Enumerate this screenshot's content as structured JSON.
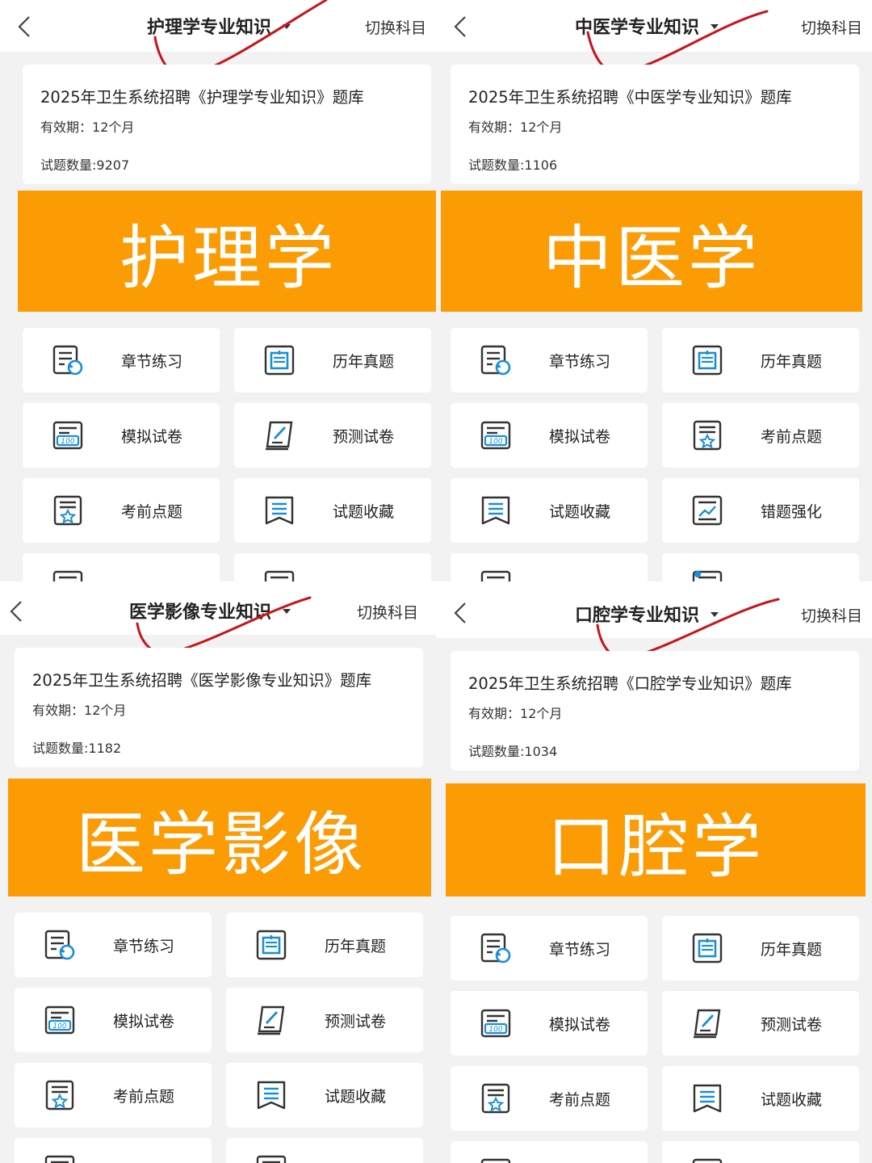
{
  "switch_label": "切换科目",
  "validity_label": "有效期：",
  "count_label": "试题数量:",
  "panels": [
    {
      "subject": "护理学专业知识",
      "bank_title": "2025年卫生系统招聘《护理学专业知识》题库",
      "validity": "12个月",
      "count": "9207",
      "banner": "护理学",
      "tiles": [
        {
          "label": "章节练习",
          "icon": "chapter-practice-icon"
        },
        {
          "label": "历年真题",
          "icon": "past-papers-icon"
        },
        {
          "label": "模拟试卷",
          "icon": "mock-exam-icon"
        },
        {
          "label": "预测试卷",
          "icon": "predicted-exam-icon"
        },
        {
          "label": "考前点题",
          "icon": "pre-exam-tips-icon"
        },
        {
          "label": "试题收藏",
          "icon": "favorites-icon"
        },
        {
          "label": "",
          "icon": "wrong-questions-icon"
        },
        {
          "label": "",
          "icon": "history-icon"
        }
      ]
    },
    {
      "subject": "中医学专业知识",
      "bank_title": "2025年卫生系统招聘《中医学专业知识》题库",
      "validity": "12个月",
      "count": "1106",
      "banner": "中医学",
      "tiles": [
        {
          "label": "章节练习",
          "icon": "chapter-practice-icon"
        },
        {
          "label": "历年真题",
          "icon": "past-papers-icon"
        },
        {
          "label": "模拟试卷",
          "icon": "mock-exam-icon"
        },
        {
          "label": "考前点题",
          "icon": "pre-exam-tips-icon"
        },
        {
          "label": "试题收藏",
          "icon": "favorites-icon"
        },
        {
          "label": "错题强化",
          "icon": "wrong-questions-icon"
        },
        {
          "label": "",
          "icon": "history-icon"
        },
        {
          "label": "",
          "icon": "notes-icon"
        }
      ]
    },
    {
      "subject": "医学影像专业知识",
      "bank_title": "2025年卫生系统招聘《医学影像专业知识》题库",
      "validity": "12个月",
      "count": "1182",
      "banner": "医学影像",
      "tiles": [
        {
          "label": "章节练习",
          "icon": "chapter-practice-icon"
        },
        {
          "label": "历年真题",
          "icon": "past-papers-icon"
        },
        {
          "label": "模拟试卷",
          "icon": "mock-exam-icon"
        },
        {
          "label": "预测试卷",
          "icon": "predicted-exam-icon"
        },
        {
          "label": "考前点题",
          "icon": "pre-exam-tips-icon"
        },
        {
          "label": "试题收藏",
          "icon": "favorites-icon"
        },
        {
          "label": "",
          "icon": "wrong-questions-icon"
        },
        {
          "label": "",
          "icon": "history-icon"
        }
      ]
    },
    {
      "subject": "口腔学专业知识",
      "bank_title": "2025年卫生系统招聘《口腔学专业知识》题库",
      "validity": "12个月",
      "count": "1034",
      "banner": "口腔学",
      "tiles": [
        {
          "label": "章节练习",
          "icon": "chapter-practice-icon"
        },
        {
          "label": "历年真题",
          "icon": "past-papers-icon"
        },
        {
          "label": "模拟试卷",
          "icon": "mock-exam-icon"
        },
        {
          "label": "预测试卷",
          "icon": "predicted-exam-icon"
        },
        {
          "label": "考前点题",
          "icon": "pre-exam-tips-icon"
        },
        {
          "label": "试题收藏",
          "icon": "favorites-icon"
        },
        {
          "label": "",
          "icon": "wrong-questions-icon"
        },
        {
          "label": "",
          "icon": "history-icon"
        }
      ]
    }
  ],
  "colors": {
    "banner": "#fc9c05",
    "icon_stroke": "#333333",
    "icon_accent": "#1a8fd6",
    "annotation": "#c8141a"
  }
}
